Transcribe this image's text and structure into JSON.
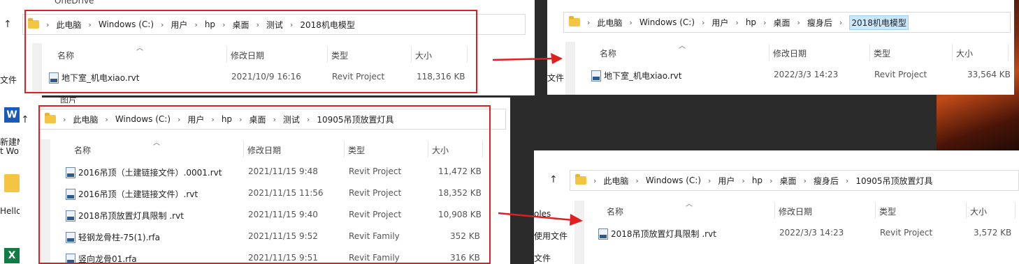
{
  "desktop": {
    "left_texts": [
      "文件",
      "新建M",
      "t Wor",
      "文件",
      "Hello"
    ],
    "onedrive_partial": "OneDrive",
    "pictures_partial": "图片",
    "mid_texts": [
      "oles",
      "使用文件",
      "文件"
    ],
    "word_icon": "W",
    "excel_icon": "X"
  },
  "windows": {
    "w1": {
      "breadcrumb": [
        "此电脑",
        "Windows (C:)",
        "用户",
        "hp",
        "桌面",
        "测试",
        "2018机电模型"
      ],
      "columns": [
        "名称",
        "修改日期",
        "类型",
        "大小"
      ],
      "rows": [
        {
          "name": "地下室_机电xiao.rvt",
          "date": "2021/10/9 16:16",
          "type": "Revit Project",
          "size": "118,316 KB"
        }
      ]
    },
    "w2": {
      "breadcrumb": [
        "此电脑",
        "Windows (C:)",
        "用户",
        "hp",
        "桌面",
        "瘦身后",
        "2018机电模型"
      ],
      "columns": [
        "名称",
        "修改日期",
        "类型",
        "大小"
      ],
      "rows": [
        {
          "name": "地下室_机电xiao.rvt",
          "date": "2022/3/3 14:23",
          "type": "Revit Project",
          "size": "33,564 KB"
        }
      ]
    },
    "w3": {
      "breadcrumb": [
        "此电脑",
        "Windows (C:)",
        "用户",
        "hp",
        "桌面",
        "测试",
        "10905吊顶放置灯具"
      ],
      "columns": [
        "名称",
        "修改日期",
        "类型",
        "大小"
      ],
      "rows": [
        {
          "name": "2016吊顶（土建链接文件）.0001.rvt",
          "date": "2021/11/15 9:48",
          "type": "Revit Project",
          "size": "11,472 KB"
        },
        {
          "name": "2016吊顶（土建链接文件）.rvt",
          "date": "2021/11/15 11:56",
          "type": "Revit Project",
          "size": "18,352 KB"
        },
        {
          "name": "2018吊顶放置灯具限制 .rvt",
          "date": "2021/11/15 9:40",
          "type": "Revit Project",
          "size": "10,908 KB"
        },
        {
          "name": "轻钢龙骨柱-75(1).rfa",
          "date": "2021/11/15 9:52",
          "type": "Revit Family",
          "size": "352 KB"
        },
        {
          "name": "竖向龙骨01.rfa",
          "date": "2021/11/15 9:51",
          "type": "Revit Family",
          "size": "316 KB"
        }
      ]
    },
    "w4": {
      "breadcrumb": [
        "此电脑",
        "Windows (C:)",
        "用户",
        "hp",
        "桌面",
        "瘦身后",
        "10905吊顶放置灯具"
      ],
      "columns": [
        "名称",
        "修改日期",
        "类型",
        "大小"
      ],
      "rows": [
        {
          "name": "2018吊顶放置灯具限制 .rvt",
          "date": "2022/3/3 14:23",
          "type": "Revit Project",
          "size": "3,572 KB"
        }
      ]
    }
  },
  "colors": {
    "annotation_red": "#e02020",
    "folder_yellow": "#f4c542",
    "selection_blue": "#cce8ff"
  }
}
